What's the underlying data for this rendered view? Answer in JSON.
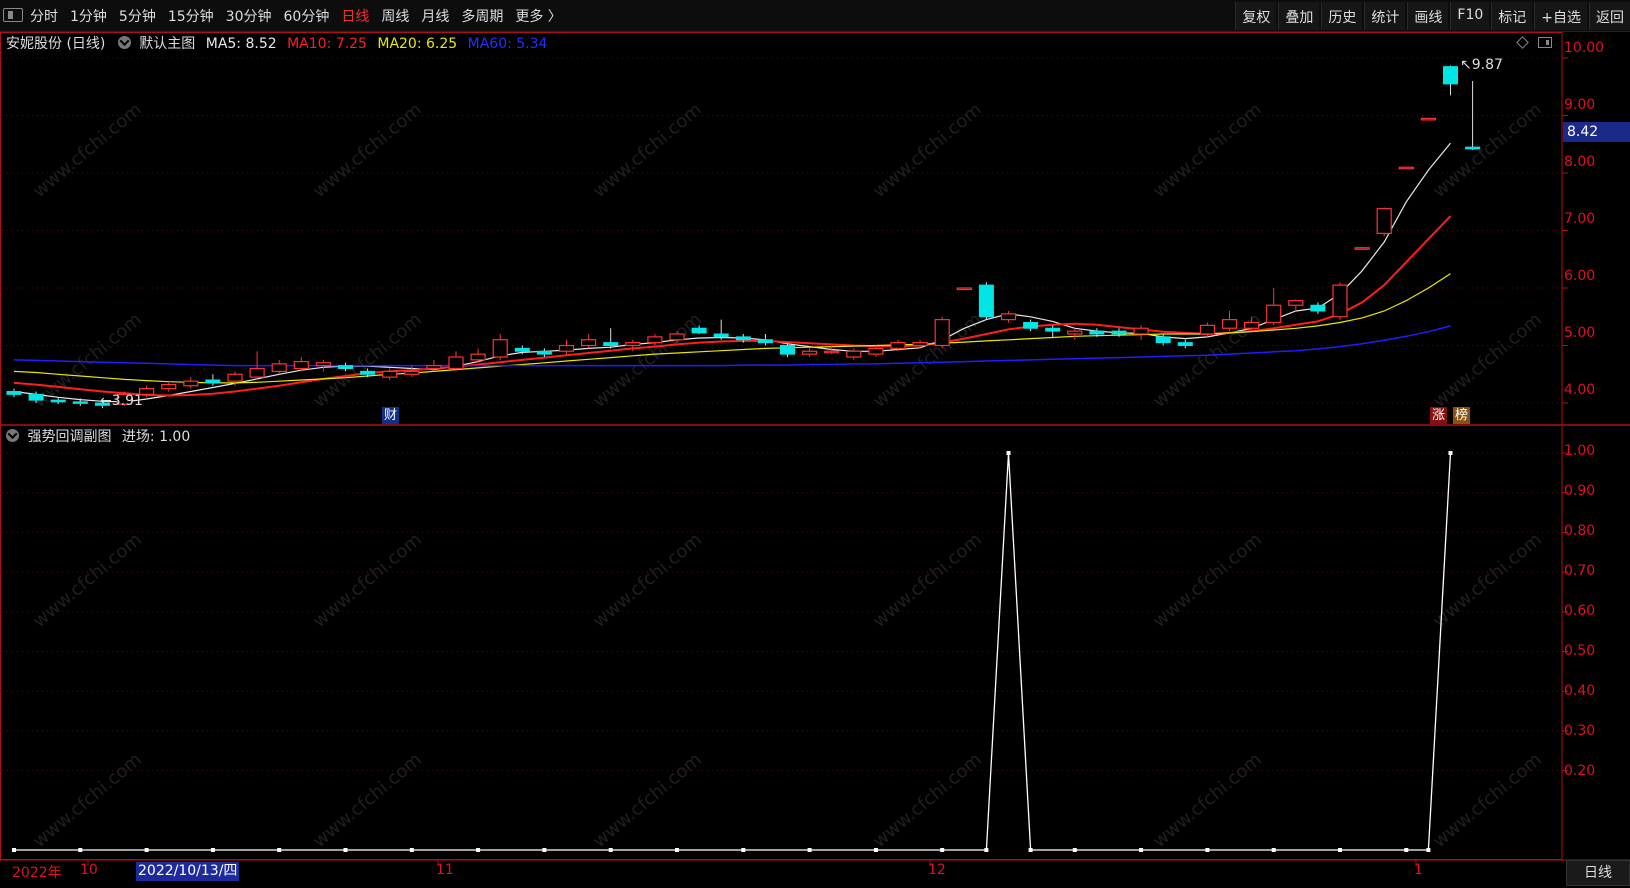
{
  "toolbar": {
    "periods": [
      "分时",
      "1分钟",
      "5分钟",
      "15分钟",
      "30分钟",
      "60分钟",
      "日线",
      "周线",
      "月线",
      "多周期",
      "更多 〉"
    ],
    "active_period_index": 6,
    "tools": [
      "复权",
      "叠加",
      "历史",
      "统计",
      "画线",
      "F10",
      "标记",
      "+自选",
      "返回"
    ]
  },
  "main_chart": {
    "title": "安妮股份 (日线)",
    "template": "默认主图",
    "ma5": {
      "label": "MA5: 8.52",
      "color": "#e8e8e8"
    },
    "ma10": {
      "label": "MA10: 7.25",
      "color": "#ff1e1e"
    },
    "ma20": {
      "label": "MA20: 6.25",
      "color": "#e8e800"
    },
    "ma60": {
      "label": "MA60: 5.34",
      "color": "#1e1eff"
    },
    "y_labels": [
      "10.00",
      "9.00",
      "8.00",
      "7.00",
      "6.00",
      "5.00",
      "4.00"
    ],
    "current_price": "8.42",
    "high_marker": "9.87",
    "low_marker": "3.91",
    "event_tags": [
      "财",
      "涨",
      "榜"
    ]
  },
  "sub_chart": {
    "indicator": "强势回调副图",
    "value_label": "进场: 1.00",
    "y_labels": [
      "1.00",
      "0.90",
      "0.80",
      "0.70",
      "0.60",
      "0.50",
      "0.40",
      "0.30",
      "0.20"
    ]
  },
  "date_axis": {
    "labels": [
      "2022年",
      "10",
      "11",
      "12",
      "1"
    ],
    "cursor_date": "2022/10/13/四",
    "period_button": "日线"
  },
  "watermark": "www.cfchi.com",
  "colors": {
    "up": "#ff3232",
    "down": "#00e5e5",
    "axis": "#b01010",
    "accent": "#f03030"
  },
  "chart_data": [
    {
      "type": "candlestick",
      "title": "安妮股份 (日线)",
      "ylim": [
        3.7,
        10.3
      ],
      "candles": [
        {
          "o": 4.2,
          "h": 4.25,
          "l": 4.1,
          "c": 4.15
        },
        {
          "o": 4.15,
          "h": 4.2,
          "l": 4.0,
          "c": 4.05
        },
        {
          "o": 4.05,
          "h": 4.1,
          "l": 3.98,
          "c": 4.02
        },
        {
          "o": 4.02,
          "h": 4.08,
          "l": 3.95,
          "c": 4.0
        },
        {
          "o": 4.0,
          "h": 4.05,
          "l": 3.91,
          "c": 3.96
        },
        {
          "o": 3.98,
          "h": 4.2,
          "l": 3.95,
          "c": 4.15
        },
        {
          "o": 4.15,
          "h": 4.3,
          "l": 4.1,
          "c": 4.25
        },
        {
          "o": 4.25,
          "h": 4.35,
          "l": 4.2,
          "c": 4.32
        },
        {
          "o": 4.3,
          "h": 4.45,
          "l": 4.25,
          "c": 4.38
        },
        {
          "o": 4.4,
          "h": 4.5,
          "l": 4.3,
          "c": 4.35
        },
        {
          "o": 4.38,
          "h": 4.55,
          "l": 4.3,
          "c": 4.5
        },
        {
          "o": 4.45,
          "h": 4.9,
          "l": 4.4,
          "c": 4.6
        },
        {
          "o": 4.55,
          "h": 4.75,
          "l": 4.5,
          "c": 4.68
        },
        {
          "o": 4.6,
          "h": 4.8,
          "l": 4.55,
          "c": 4.72
        },
        {
          "o": 4.65,
          "h": 4.75,
          "l": 4.55,
          "c": 4.7
        },
        {
          "o": 4.65,
          "h": 4.7,
          "l": 4.55,
          "c": 4.6
        },
        {
          "o": 4.55,
          "h": 4.6,
          "l": 4.45,
          "c": 4.5
        },
        {
          "o": 4.45,
          "h": 4.6,
          "l": 4.4,
          "c": 4.55
        },
        {
          "o": 4.5,
          "h": 4.65,
          "l": 4.45,
          "c": 4.55
        },
        {
          "o": 4.6,
          "h": 4.75,
          "l": 4.55,
          "c": 4.65
        },
        {
          "o": 4.6,
          "h": 4.9,
          "l": 4.55,
          "c": 4.8
        },
        {
          "o": 4.75,
          "h": 4.95,
          "l": 4.7,
          "c": 4.85
        },
        {
          "o": 4.8,
          "h": 5.2,
          "l": 4.75,
          "c": 5.1
        },
        {
          "o": 4.95,
          "h": 5.0,
          "l": 4.85,
          "c": 4.9
        },
        {
          "o": 4.9,
          "h": 4.95,
          "l": 4.8,
          "c": 4.85
        },
        {
          "o": 4.9,
          "h": 5.1,
          "l": 4.85,
          "c": 5.0
        },
        {
          "o": 5.0,
          "h": 5.2,
          "l": 4.95,
          "c": 5.1
        },
        {
          "o": 5.05,
          "h": 5.3,
          "l": 4.95,
          "c": 5.0
        },
        {
          "o": 5.0,
          "h": 5.1,
          "l": 4.9,
          "c": 5.05
        },
        {
          "o": 5.05,
          "h": 5.2,
          "l": 5.0,
          "c": 5.15
        },
        {
          "o": 5.1,
          "h": 5.25,
          "l": 5.05,
          "c": 5.2
        },
        {
          "o": 5.3,
          "h": 5.35,
          "l": 5.2,
          "c": 5.22
        },
        {
          "o": 5.2,
          "h": 5.45,
          "l": 5.1,
          "c": 5.15
        },
        {
          "o": 5.15,
          "h": 5.2,
          "l": 5.05,
          "c": 5.1
        },
        {
          "o": 5.1,
          "h": 5.2,
          "l": 5.0,
          "c": 5.05
        },
        {
          "o": 5.0,
          "h": 5.05,
          "l": 4.8,
          "c": 4.85
        },
        {
          "o": 4.85,
          "h": 4.95,
          "l": 4.8,
          "c": 4.9
        },
        {
          "o": 4.9,
          "h": 5.0,
          "l": 4.85,
          "c": 4.9
        },
        {
          "o": 4.8,
          "h": 4.95,
          "l": 4.75,
          "c": 4.9
        },
        {
          "o": 4.85,
          "h": 5.0,
          "l": 4.8,
          "c": 4.95
        },
        {
          "o": 4.95,
          "h": 5.1,
          "l": 4.9,
          "c": 5.05
        },
        {
          "o": 5.0,
          "h": 5.1,
          "l": 4.95,
          "c": 5.05
        },
        {
          "o": 5.0,
          "h": 5.5,
          "l": 4.95,
          "c": 5.45
        },
        {
          "o": 6.0,
          "h": 6.0,
          "l": 6.0,
          "c": 6.0
        },
        {
          "o": 6.05,
          "h": 6.1,
          "l": 5.45,
          "c": 5.5
        },
        {
          "o": 5.45,
          "h": 5.6,
          "l": 5.4,
          "c": 5.55
        },
        {
          "o": 5.4,
          "h": 5.45,
          "l": 5.25,
          "c": 5.3
        },
        {
          "o": 5.3,
          "h": 5.35,
          "l": 5.15,
          "c": 5.25
        },
        {
          "o": 5.2,
          "h": 5.3,
          "l": 5.1,
          "c": 5.25
        },
        {
          "o": 5.25,
          "h": 5.3,
          "l": 5.15,
          "c": 5.2
        },
        {
          "o": 5.25,
          "h": 5.3,
          "l": 5.15,
          "c": 5.2
        },
        {
          "o": 5.2,
          "h": 5.35,
          "l": 5.1,
          "c": 5.3
        },
        {
          "o": 5.15,
          "h": 5.2,
          "l": 5.0,
          "c": 5.05
        },
        {
          "o": 5.05,
          "h": 5.1,
          "l": 4.95,
          "c": 5.0
        },
        {
          "o": 5.2,
          "h": 5.4,
          "l": 5.15,
          "c": 5.35
        },
        {
          "o": 5.3,
          "h": 5.6,
          "l": 5.25,
          "c": 5.45
        },
        {
          "o": 5.3,
          "h": 5.5,
          "l": 5.25,
          "c": 5.4
        },
        {
          "o": 5.4,
          "h": 6.0,
          "l": 5.35,
          "c": 5.7
        },
        {
          "o": 5.7,
          "h": 5.8,
          "l": 5.6,
          "c": 5.78
        },
        {
          "o": 5.7,
          "h": 5.75,
          "l": 5.55,
          "c": 5.6
        },
        {
          "o": 5.5,
          "h": 6.1,
          "l": 5.45,
          "c": 6.05
        },
        {
          "o": 6.7,
          "h": 6.7,
          "l": 6.7,
          "c": 6.7
        },
        {
          "o": 6.95,
          "h": 7.4,
          "l": 6.9,
          "c": 7.38
        },
        {
          "o": 8.1,
          "h": 8.1,
          "l": 8.1,
          "c": 8.1
        },
        {
          "o": 8.95,
          "h": 8.95,
          "l": 8.95,
          "c": 8.95
        },
        {
          "o": 9.85,
          "h": 9.87,
          "l": 9.35,
          "c": 9.55
        },
        {
          "o": 8.45,
          "h": 9.6,
          "l": 8.4,
          "c": 8.42
        }
      ],
      "series": [
        {
          "name": "MA5",
          "values": [
            4.2,
            4.15,
            4.1,
            4.06,
            4.03,
            4.02,
            4.07,
            4.13,
            4.2,
            4.27,
            4.34,
            4.42,
            4.5,
            4.57,
            4.62,
            4.64,
            4.64,
            4.62,
            4.6,
            4.58,
            4.64,
            4.72,
            4.82,
            4.88,
            4.9,
            4.92,
            4.95,
            4.97,
            5.02,
            5.05,
            5.1,
            5.13,
            5.14,
            5.13,
            5.1,
            5.03,
            4.98,
            4.93,
            4.9,
            4.9,
            4.93,
            4.96,
            5.1,
            5.3,
            5.45,
            5.55,
            5.5,
            5.42,
            5.3,
            5.25,
            5.22,
            5.21,
            5.15,
            5.12,
            5.15,
            5.22,
            5.3,
            5.45,
            5.6,
            5.65,
            5.9,
            6.3,
            6.8,
            7.5,
            8.05,
            8.52
          ]
        },
        {
          "name": "MA10",
          "values": [
            4.35,
            4.32,
            4.28,
            4.24,
            4.2,
            4.17,
            4.14,
            4.13,
            4.14,
            4.16,
            4.2,
            4.25,
            4.3,
            4.36,
            4.42,
            4.47,
            4.52,
            4.55,
            4.57,
            4.6,
            4.63,
            4.67,
            4.71,
            4.75,
            4.79,
            4.83,
            4.87,
            4.91,
            4.95,
            4.98,
            5.02,
            5.05,
            5.07,
            5.08,
            5.08,
            5.06,
            5.04,
            5.02,
            5.0,
            4.99,
            4.99,
            5.0,
            5.05,
            5.12,
            5.2,
            5.28,
            5.33,
            5.36,
            5.38,
            5.36,
            5.32,
            5.28,
            5.24,
            5.22,
            5.2,
            5.22,
            5.25,
            5.3,
            5.36,
            5.42,
            5.55,
            5.75,
            6.05,
            6.45,
            6.85,
            7.25
          ]
        },
        {
          "name": "MA20",
          "values": [
            4.55,
            4.53,
            4.5,
            4.47,
            4.44,
            4.41,
            4.39,
            4.37,
            4.36,
            4.35,
            4.35,
            4.36,
            4.38,
            4.4,
            4.42,
            4.44,
            4.47,
            4.5,
            4.52,
            4.55,
            4.58,
            4.61,
            4.64,
            4.67,
            4.7,
            4.73,
            4.76,
            4.79,
            4.82,
            4.85,
            4.87,
            4.89,
            4.91,
            4.93,
            4.95,
            4.96,
            4.97,
            4.98,
            4.99,
            5.0,
            5.01,
            5.02,
            5.04,
            5.06,
            5.08,
            5.1,
            5.12,
            5.14,
            5.16,
            5.17,
            5.18,
            5.19,
            5.2,
            5.2,
            5.2,
            5.22,
            5.24,
            5.27,
            5.3,
            5.34,
            5.4,
            5.48,
            5.6,
            5.78,
            6.0,
            6.25
          ]
        },
        {
          "name": "MA60",
          "values": [
            4.75,
            4.74,
            4.73,
            4.72,
            4.71,
            4.7,
            4.69,
            4.68,
            4.67,
            4.66,
            4.65,
            4.65,
            4.65,
            4.65,
            4.65,
            4.65,
            4.65,
            4.65,
            4.65,
            4.65,
            4.65,
            4.65,
            4.65,
            4.65,
            4.65,
            4.65,
            4.65,
            4.65,
            4.65,
            4.65,
            4.65,
            4.65,
            4.65,
            4.66,
            4.66,
            4.66,
            4.67,
            4.67,
            4.68,
            4.68,
            4.69,
            4.7,
            4.71,
            4.72,
            4.73,
            4.74,
            4.75,
            4.76,
            4.77,
            4.78,
            4.79,
            4.8,
            4.81,
            4.82,
            4.83,
            4.85,
            4.87,
            4.89,
            4.91,
            4.94,
            4.98,
            5.03,
            5.09,
            5.16,
            5.24,
            5.34
          ]
        }
      ]
    },
    {
      "type": "line",
      "title": "强势回调副图",
      "ylim": [
        0,
        1.0
      ],
      "series": [
        {
          "name": "进场",
          "x_index": [
            0,
            3,
            6,
            9,
            12,
            15,
            18,
            21,
            24,
            27,
            30,
            33,
            36,
            39,
            42,
            44,
            45,
            46,
            48,
            51,
            54,
            57,
            60,
            63,
            64,
            65
          ],
          "values": [
            0,
            0,
            0,
            0,
            0,
            0,
            0,
            0,
            0,
            0,
            0,
            0,
            0,
            0,
            0,
            0,
            1,
            0,
            0,
            0,
            0,
            0,
            0,
            0,
            0,
            1
          ]
        }
      ]
    }
  ]
}
